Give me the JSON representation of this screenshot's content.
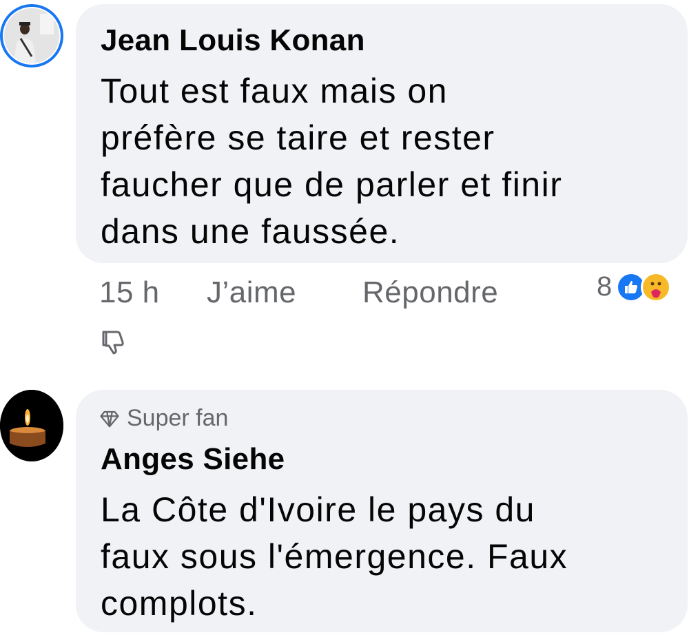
{
  "comments": [
    {
      "author": "Jean Louis Konan",
      "text": "Tout est faux mais on\npréfère se taire et rester\nfaucher que de parler et finir\ndans une faussée.",
      "time": "15 h",
      "like_label": "J’aime",
      "reply_label": "Répondre",
      "reaction_count": "8",
      "reactions": [
        "like-icon",
        "care-icon"
      ],
      "avatar_ring_color": "#1877f2"
    },
    {
      "badge": "Super fan",
      "author": "Anges Siehe",
      "text": "La Côte d'Ivoire le pays du\nfaux sous l'émergence. Faux\ncomplots."
    }
  ],
  "colors": {
    "bubble": "#f0f2f5",
    "secondary_text": "#65676b",
    "accent": "#1877f2"
  }
}
